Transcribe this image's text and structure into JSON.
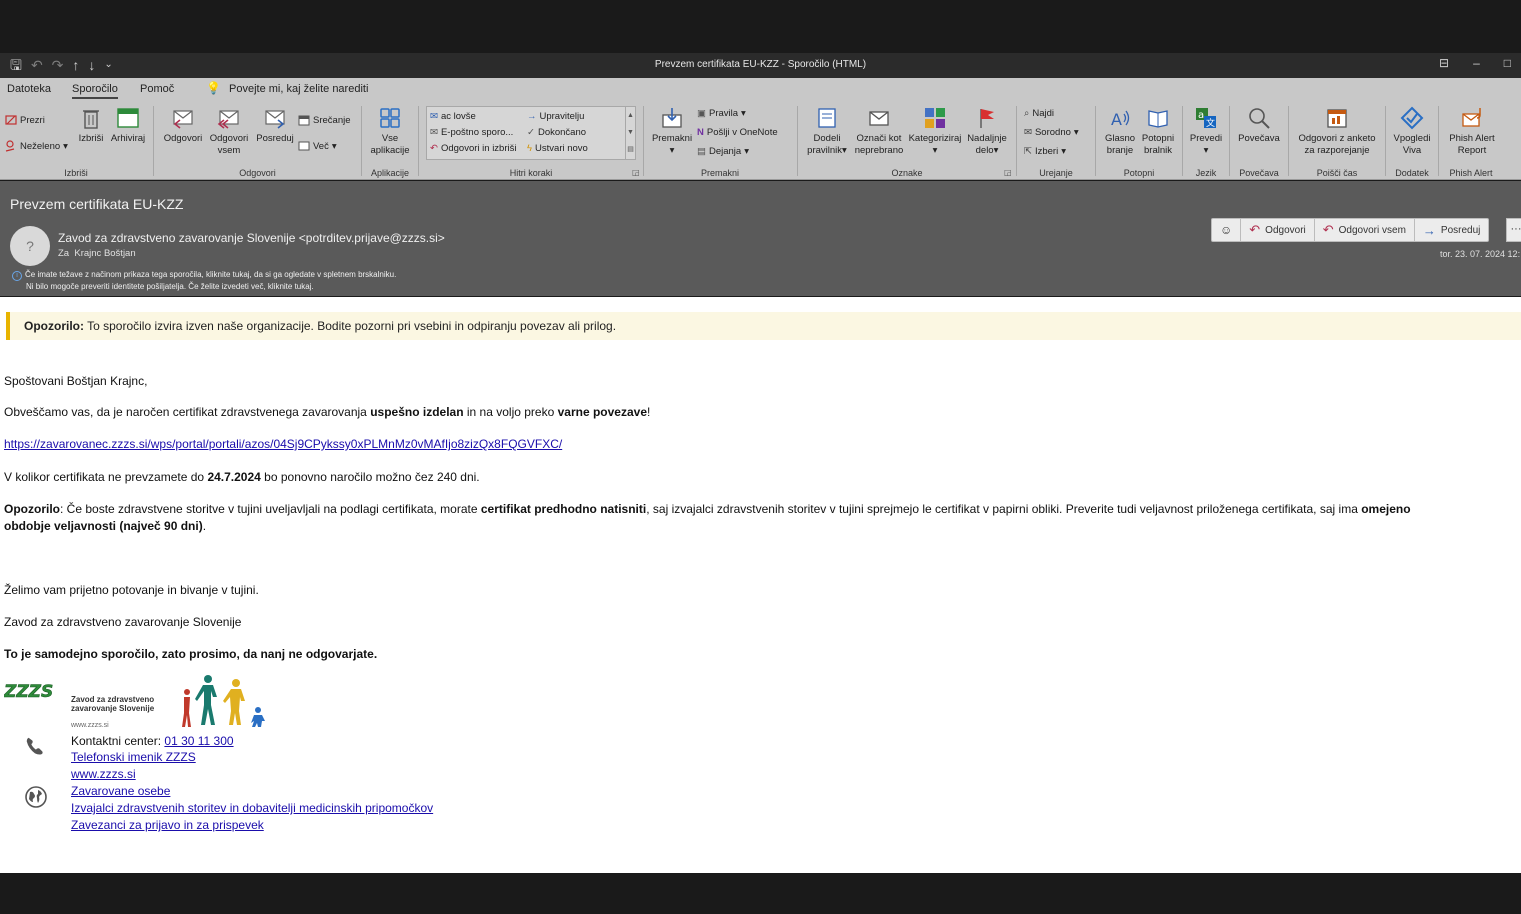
{
  "window": {
    "title": "Prevzem certifikata EU-KZZ  -  Sporočilo (HTML)"
  },
  "ribbon_tabs": {
    "datoteka": "Datoteka",
    "sporocilo": "Sporočilo",
    "pomoc": "Pomoč",
    "tell_me": "Povejte mi, kaj želite narediti"
  },
  "ribbon": {
    "izbrisi_group": {
      "prezri": "Prezri",
      "nezeleno": "Neželeno",
      "izbrisi": "Izbriši",
      "arhiviraj": "Arhiviraj",
      "label": "Izbriši"
    },
    "odgovori_group": {
      "odgovori": "Odgovori",
      "odgovori_vsem_1": "Odgovori",
      "odgovori_vsem_2": "vsem",
      "posreduj": "Posreduj",
      "srecanje": "Srečanje",
      "vec": "Več",
      "label": "Odgovori"
    },
    "aplikacije_group": {
      "vse_1": "Vse",
      "vse_2": "aplikacije",
      "label": "Aplikacije"
    },
    "hitri_koraki": {
      "items": [
        "ac lovše",
        "E-poštno sporo...",
        "Odgovori in izbriši",
        "Upravitelju",
        "Dokončano",
        "Ustvari novo"
      ],
      "label": "Hitri koraki"
    },
    "premakni_group": {
      "premakni": "Premakni",
      "pravila": "Pravila",
      "onenote": "Pošlji v OneNote",
      "dejanja": "Dejanja",
      "label": "Premakni"
    },
    "oznake_group": {
      "dodeli_1": "Dodeli",
      "dodeli_2": "pravilnik",
      "oznaci_1": "Označi kot",
      "oznaci_2": "neprebrano",
      "kategoriziraj": "Kategoriziraj",
      "nadaljnje_1": "Nadaljnje",
      "nadaljnje_2": "delo",
      "label": "Oznake"
    },
    "urejanje_group": {
      "najdi": "Najdi",
      "sorodno": "Sorodno",
      "izberi": "Izberi",
      "label": "Urejanje"
    },
    "potopni_group": {
      "glasno_1": "Glasno",
      "glasno_2": "branje",
      "bralnik_1": "Potopni",
      "bralnik_2": "bralnik",
      "label": "Potopni"
    },
    "jezik_group": {
      "prevedi": "Prevedi",
      "label": "Jezik"
    },
    "povecava_group": {
      "povecava": "Povečava",
      "label": "Povečava"
    },
    "poisci_group": {
      "anketa_1": "Odgovori z anketo",
      "anketa_2": "za razporejanje",
      "label": "Poišči čas"
    },
    "dodatek_group": {
      "viva_1": "Vpogledi",
      "viva_2": "Viva",
      "label": "Dodatek"
    },
    "phish_group": {
      "phish_1": "Phish Alert",
      "phish_2": "Report",
      "label": "Phish Alert"
    }
  },
  "message": {
    "subject": "Prevzem certifikata EU-KZZ",
    "avatar": "?",
    "from": "Zavod za zdravstveno zavarovanje Slovenije <potrditev.prijave@zzzs.si>",
    "to_label": "Za",
    "to": "Krajnc Boštjan",
    "info_line_1": "Če imate težave z načinom prikaza tega sporočila, kliknite tukaj, da si ga ogledate v spletnem brskalniku.",
    "info_line_2": "Ni bilo mogoče preveriti identitete pošiljatelja. Če želite izvedeti več, kliknite tukaj.",
    "date": "tor. 23. 07. 2024 12:",
    "actions": {
      "reply": "Odgovori",
      "reply_all": "Odgovori vsem",
      "forward": "Posreduj",
      "more": "···"
    }
  },
  "body": {
    "warning_bold": "Opozorilo:",
    "warning_text": " To sporočilo izvira izven naše organizacije. Bodite pozorni pri vsebini in odpiranju povezav ali prilog.",
    "greeting": "Spoštovani Boštjan Krajnc,",
    "p1_a": "Obveščamo vas, da je naročen certifikat zdravstvenega zavarovanja ",
    "p1_b": "uspešno izdelan",
    "p1_c": " in na voljo preko ",
    "p1_d": "varne povezave",
    "p1_e": "!",
    "link": "https://zavarovanec.zzzs.si/wps/portal/portali/azos/04Sj9CPykssy0xPLMnMz0vMAfIjo8zizQx8FQGVFXC/",
    "p2_a": "V kolikor certifikata ne prevzamete do ",
    "p2_b": "24.7.2024",
    "p2_c": " bo ponovno naročilo možno čez 240 dni.",
    "p3_a": "Opozorilo",
    "p3_b": ": Če boste zdravstvene storitve v tujini uveljavljali na podlagi certifikata, morate ",
    "p3_c": "certifikat predhodno natisniti",
    "p3_d": ", saj izvajalci zdravstvenih storitev v tujini sprejmejo le certifikat v papirni obliki. Preverite tudi veljavnost priloženega certifikata, saj ima ",
    "p3_e": "omejeno",
    "p3_f": "obdobje veljavnosti (največ 90 dni)",
    "p3_g": ".",
    "wish": "Želimo vam prijetno potovanje in bivanje v tujini.",
    "signoff": "Zavod za zdravstveno zavarovanje Slovenije",
    "noreply": "To je samodejno sporočilo, zato prosimo, da nanj ne odgovarjate."
  },
  "signature": {
    "logo_text": "ZZZS",
    "org_1": "Zavod za zdravstveno",
    "org_2": "zavarovanje Slovenije",
    "web_small": "www.zzzs.si",
    "contact_label": "Kontaktni center: ",
    "contact_phone": "01 30 11 300",
    "links": [
      "Telefonski imenik ZZZS",
      "www.zzzs.si",
      "Zavarovane osebe",
      "Izvajalci zdravstvenih storitev in dobavitelji medicinskih pripomočkov",
      "Zavezanci za prijavo in za prispevek"
    ]
  },
  "colors": {
    "ribbon_bg": "#c8c8c8",
    "header_bg": "#5a5a5a",
    "warning_accent": "#e8b400",
    "link": "#1a0dab"
  }
}
